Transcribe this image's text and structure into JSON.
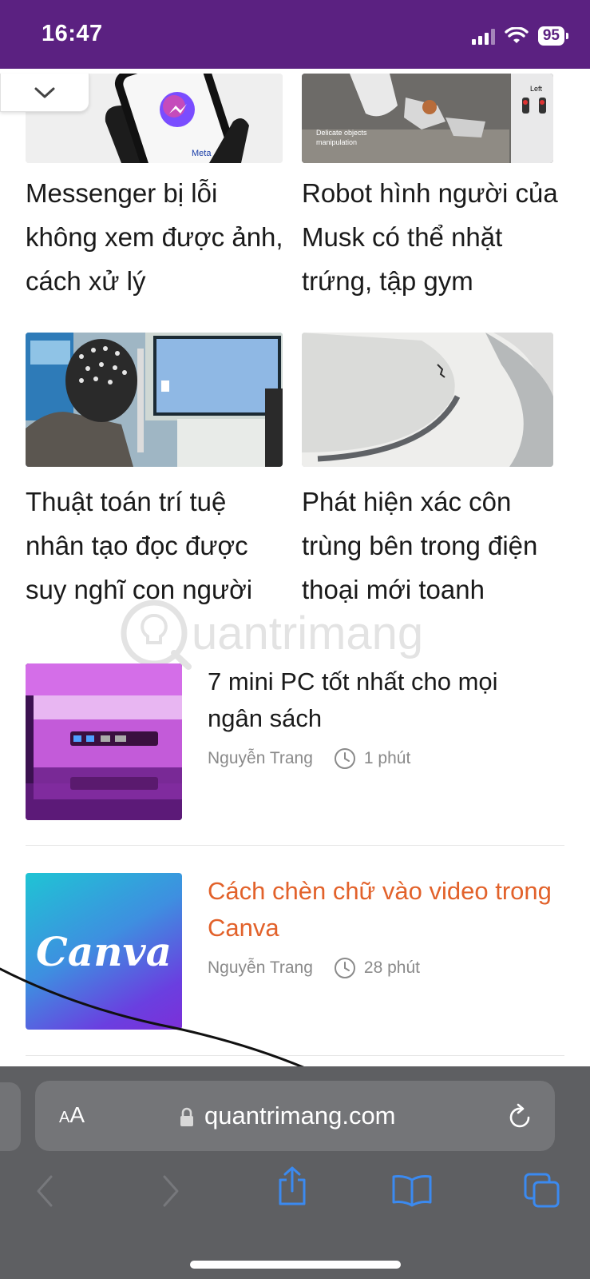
{
  "status_bar": {
    "time": "16:47",
    "battery": "95",
    "background": "#5b2181"
  },
  "collapse_tab": {
    "icon": "chevron-down-icon"
  },
  "grid_articles": [
    {
      "title": "Messenger bị lỗi không xem được ảnh, cách xử lý",
      "thumb": "messenger"
    },
    {
      "title": "Robot hình người của Musk có thể nhặt trứng, tập gym",
      "thumb": "robot",
      "thumb_caption": "Delicate objects manipulation",
      "thumb_side_label": "Left"
    },
    {
      "title": "Thuật toán trí tuệ nhân tạo đọc được suy nghĩ con người",
      "thumb": "eeg"
    },
    {
      "title": "Phát hiện xác côn trùng bên trong điện thoại mới toanh",
      "thumb": "insect"
    }
  ],
  "messenger_thumb_brand": "Meta",
  "watermark_text": "uantrimang",
  "list_articles": [
    {
      "title": "7 mini PC tốt nhất cho mọi ngân sách",
      "author": "Nguyễn Trang",
      "time": "1 phút",
      "highlighted": false
    },
    {
      "title": "Cách chèn chữ vào video trong Canva",
      "author": "Nguyễn Trang",
      "time": "28 phút",
      "highlighted": true,
      "thumb_text": "Canva"
    }
  ],
  "browser": {
    "aa_small": "A",
    "aa_big": "A",
    "url": "quantrimang.com",
    "icons": [
      "lock-icon",
      "reload-icon",
      "back-icon",
      "forward-icon",
      "share-icon",
      "bookmarks-icon",
      "tabs-icon"
    ]
  },
  "colors": {
    "accent_title": "#e2622b",
    "browser_blue": "#3b8af0",
    "browser_bar": "#5e5f62"
  }
}
